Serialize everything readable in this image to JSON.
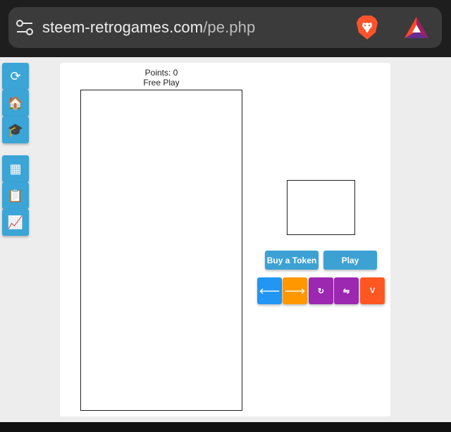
{
  "browser": {
    "url_host": "steem-retrogames.com",
    "url_path": "/pe.php",
    "site_settings_icon": "tune-icon",
    "brave_icon": "brave-lion-icon",
    "rewards_icon": "bat-rewards-icon"
  },
  "sidebar": {
    "items": [
      {
        "icon": "refresh-icon",
        "glyph": "⟳"
      },
      {
        "icon": "home-icon",
        "glyph": "🏠"
      },
      {
        "icon": "graduation-cap-icon",
        "glyph": "🎓"
      },
      {
        "icon": "grid-icon",
        "glyph": "▦"
      },
      {
        "icon": "clipboard-icon",
        "glyph": "📋"
      },
      {
        "icon": "chart-icon",
        "glyph": "📈"
      }
    ]
  },
  "game": {
    "points_text": "Points: 0",
    "mode_text": "Free Play",
    "buy_token_label": "Buy a Token",
    "play_label": "Play",
    "controls": [
      {
        "name": "left-arrow",
        "glyph": "🡐",
        "color": "#2196f3"
      },
      {
        "name": "right-arrow",
        "glyph": "🡒",
        "color": "#ff9800"
      },
      {
        "name": "rotate",
        "glyph": "↻",
        "color": "#9c27b0"
      },
      {
        "name": "flip",
        "glyph": "⇋",
        "color": "#9c27b0"
      },
      {
        "name": "drop",
        "glyph": "V",
        "color": "#ff5722"
      }
    ]
  }
}
